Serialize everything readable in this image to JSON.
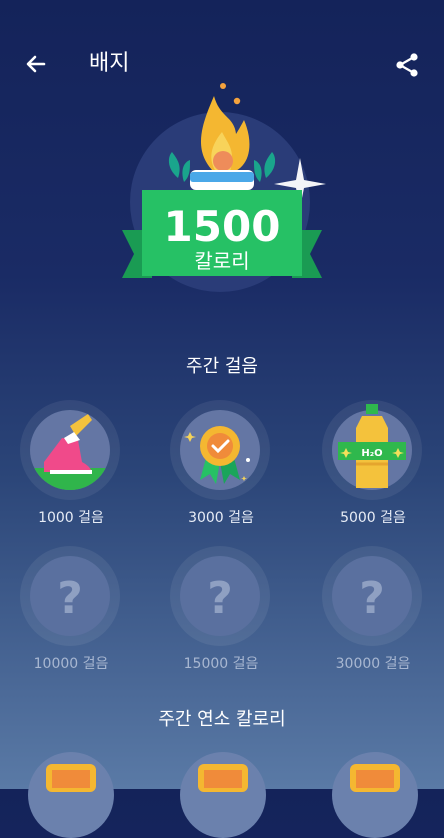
{
  "header": {
    "title": "배지",
    "back_icon": "arrow-left-icon",
    "share_icon": "share-icon"
  },
  "hero": {
    "value": "1500",
    "unit": "칼로리"
  },
  "sections": {
    "weekly_steps": "주간 걸음",
    "weekly_calories": "주간 연소 칼로리"
  },
  "steps_badges": [
    {
      "label": "1000 걸음",
      "icon": "sneaker-icon",
      "locked": false
    },
    {
      "label": "3000 걸음",
      "icon": "medal-icon",
      "locked": false
    },
    {
      "label": "5000 걸음",
      "icon": "water-bottle-icon",
      "locked": false,
      "bottle_text": "H₂O"
    },
    {
      "label": "10000 걸음",
      "icon": "question-icon",
      "locked": true,
      "glyph": "?"
    },
    {
      "label": "15000 걸음",
      "icon": "question-icon",
      "locked": true,
      "glyph": "?"
    },
    {
      "label": "30000 걸음",
      "icon": "question-icon",
      "locked": true,
      "glyph": "?"
    }
  ]
}
